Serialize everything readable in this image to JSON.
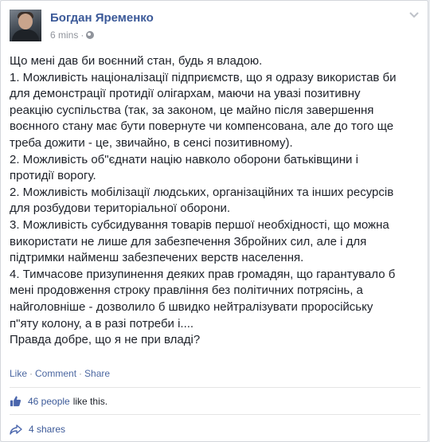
{
  "post": {
    "author": "Богдан Яременко",
    "time": "6 mins",
    "separator": "·",
    "lines": [
      "Що мені дав би воєнний стан, будь я владою.",
      "1. Можливість націоналізації підприємств, що я одразу використав би",
      "для демонстрації протидії олігархам, маючи на увазі позитивну",
      "реакцію суспільства (так, за законом, це майно після завершення",
      "воєнного стану має бути повернуте чи компенсована, але до того ще",
      "треба дожити - це, звичайно, в сенсі позитивному).",
      "2. Можливість об\"єднати націю навколо оборони батьківщини і",
      "протидії ворогу.",
      "2. Можливість мобілізації людських, організаційних та інших ресурсів",
      "для розбудови територіальної оборони.",
      "3. Можливість субсидування товарів першої необхідності, що можна",
      "використати не лише для забезпечення Збройних сил, але і для",
      "підтримки найменш забезпечених верств населення.",
      "4. Тимчасове призупинення деяких прав громадян, що гарантувало б",
      "мені продовження строку правління без політичних потрясінь, а",
      "найголовніше - дозволило б швидко нейтралізувати проросійську",
      "п\"яту колону, а в разі потреби і....",
      "Правда добре, що я не при владі?"
    ]
  },
  "actions": {
    "like": "Like",
    "comment": "Comment",
    "share": "Share",
    "separator": "·"
  },
  "likes": {
    "count": "46 people",
    "suffix": "like this."
  },
  "shares": {
    "label": "4 shares"
  },
  "colors": {
    "link": "#3b5998",
    "text": "#1d2129",
    "meta": "#90949c"
  },
  "icons": [
    "globe-icon",
    "chevron-down-icon",
    "thumbs-up-icon",
    "share-arrow-icon"
  ]
}
